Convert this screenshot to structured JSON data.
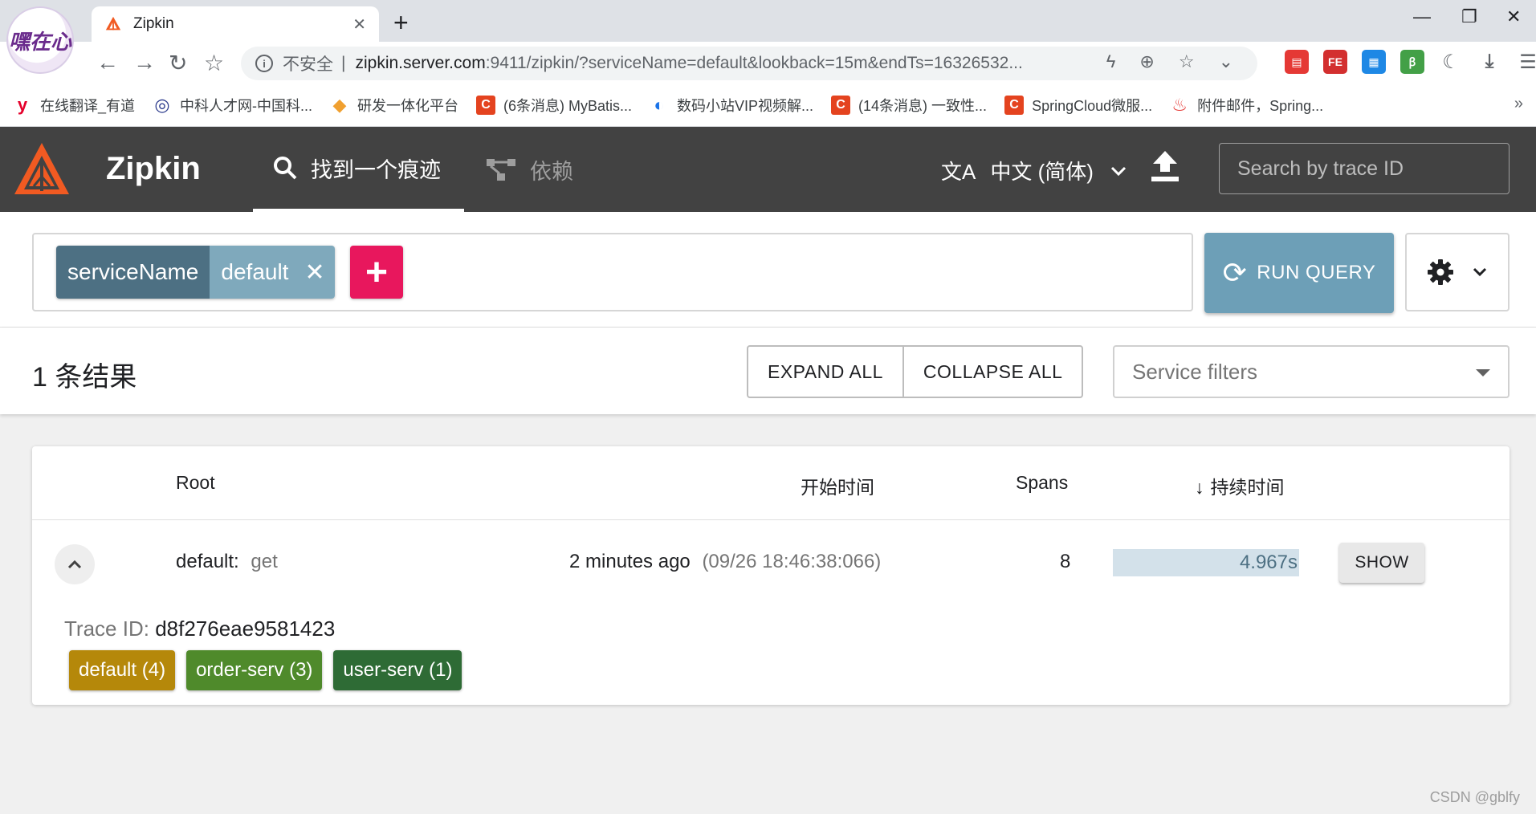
{
  "browser": {
    "profile_text": "嘿在心",
    "tab_title": "Zipkin",
    "url_insecure": "不安全",
    "url_host": "zipkin.server.com",
    "url_rest": ":9411/zipkin/?serviceName=default&lookback=15m&endTs=16326532...",
    "bookmarks": [
      {
        "label": "在线翻译_有道",
        "icon": "y",
        "color": "#e5002b"
      },
      {
        "label": "中科人才网-中国科...",
        "icon": "◎",
        "color": "#2b3a8c"
      },
      {
        "label": "研发一体化平台",
        "icon": "◆",
        "color": "#f0a030"
      },
      {
        "label": "(6条消息) MyBatis...",
        "icon": "C",
        "color": "#e4431f"
      },
      {
        "label": "数码小站VIP视频解...",
        "icon": "◐",
        "color": "#1a73e8"
      },
      {
        "label": "(14条消息) 一致性...",
        "icon": "C",
        "color": "#e4431f"
      },
      {
        "label": "SpringCloud微服...",
        "icon": "C",
        "color": "#e4431f"
      },
      {
        "label": "附件邮件，Spring...",
        "icon": "♨",
        "color": "#e53935"
      }
    ],
    "more": "»"
  },
  "header": {
    "brand": "Zipkin",
    "nav_find": "找到一个痕迹",
    "nav_deps": "依赖",
    "language": "中文 (简体)",
    "search_placeholder": "Search by trace ID"
  },
  "query": {
    "chip_key": "serviceName",
    "chip_value": "default",
    "run_label": "RUN QUERY"
  },
  "results": {
    "count_label": "1 条结果",
    "expand_all": "EXPAND ALL",
    "collapse_all": "COLLAPSE ALL",
    "service_filters_placeholder": "Service filters"
  },
  "table": {
    "headers": {
      "root": "Root",
      "start": "开始时间",
      "spans": "Spans",
      "duration": "持续时间"
    },
    "rows": [
      {
        "service": "default:",
        "name": "get",
        "start_relative": "2 minutes ago",
        "start_absolute": "(09/26 18:46:38:066)",
        "spans": "8",
        "duration": "4.967s",
        "duration_fraction": 1.0,
        "show_label": "SHOW",
        "trace_id_label": "Trace ID:",
        "trace_id": "d8f276eae9581423",
        "services": [
          {
            "label": "default (4)",
            "color": "#b5880a"
          },
          {
            "label": "order-serv (3)",
            "color": "#4f8a2b"
          },
          {
            "label": "user-serv (1)",
            "color": "#2e6b35"
          }
        ]
      }
    ]
  },
  "watermark": "CSDN @gblfy"
}
